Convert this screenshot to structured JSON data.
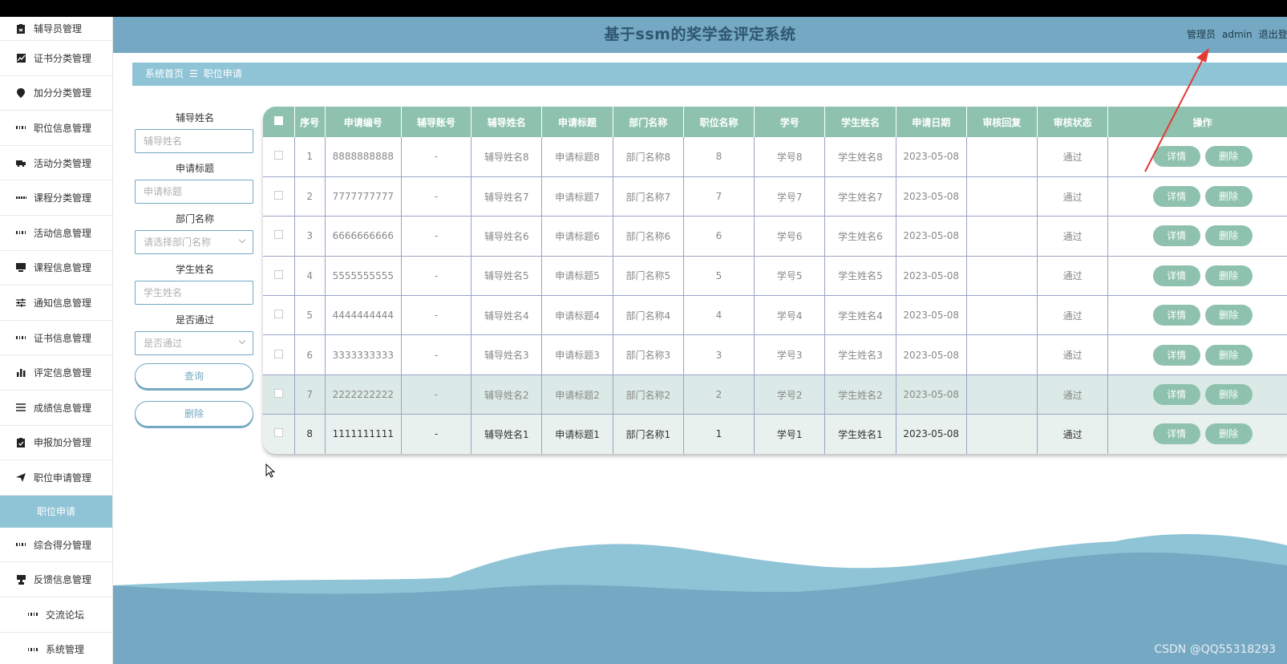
{
  "app": {
    "title": "基于ssm的奖学金评定系统"
  },
  "header": {
    "user_role": "管理员",
    "user_name": "admin",
    "logout": "退出登录"
  },
  "sidebar": {
    "items": [
      {
        "label": "辅导员管理",
        "icon": "clipboard-icon"
      },
      {
        "label": "证书分类管理",
        "icon": "chart-icon"
      },
      {
        "label": "加分分类管理",
        "icon": "pin-icon"
      },
      {
        "label": "职位信息管理",
        "icon": "grid-icon"
      },
      {
        "label": "活动分类管理",
        "icon": "truck-icon"
      },
      {
        "label": "课程分类管理",
        "icon": "grid9-icon"
      },
      {
        "label": "活动信息管理",
        "icon": "grid-icon"
      },
      {
        "label": "课程信息管理",
        "icon": "monitor-icon"
      },
      {
        "label": "通知信息管理",
        "icon": "sliders-icon"
      },
      {
        "label": "证书信息管理",
        "icon": "grid-icon"
      },
      {
        "label": "评定信息管理",
        "icon": "bar-chart-icon"
      },
      {
        "label": "成绩信息管理",
        "icon": "list-icon"
      },
      {
        "label": "申报加分管理",
        "icon": "clipboard-check-icon"
      },
      {
        "label": "职位申请管理",
        "icon": "send-icon"
      },
      {
        "label": "职位申请",
        "icon": "",
        "active": true
      },
      {
        "label": "综合得分管理",
        "icon": "grid-icon"
      },
      {
        "label": "反馈信息管理",
        "icon": "stamp-icon"
      },
      {
        "label": "交流论坛",
        "icon": "grid-icon"
      },
      {
        "label": "系统管理",
        "icon": "grid-icon"
      }
    ]
  },
  "breadcrumb": {
    "home": "系统首页",
    "separator": "☰",
    "current": "职位申请"
  },
  "search": {
    "fields": [
      {
        "label": "辅导姓名",
        "placeholder": "辅导姓名",
        "type": "input"
      },
      {
        "label": "申请标题",
        "placeholder": "申请标题",
        "type": "input"
      },
      {
        "label": "部门名称",
        "placeholder": "请选择部门名称",
        "type": "select"
      },
      {
        "label": "学生姓名",
        "placeholder": "学生姓名",
        "type": "input"
      },
      {
        "label": "是否通过",
        "placeholder": "是否通过",
        "type": "select"
      }
    ],
    "query_button": "查询",
    "delete_button": "删除"
  },
  "table": {
    "columns": [
      "序号",
      "申请编号",
      "辅导账号",
      "辅导姓名",
      "申请标题",
      "部门名称",
      "职位名称",
      "学号",
      "学生姓名",
      "申请日期",
      "审核回复",
      "审核状态",
      "操作"
    ],
    "rows": [
      [
        "1",
        "8888888888",
        "-",
        "辅导姓名8",
        "申请标题8",
        "部门名称8",
        "8",
        "学号8",
        "学生姓名8",
        "2023-05-08",
        "",
        "通过"
      ],
      [
        "2",
        "7777777777",
        "-",
        "辅导姓名7",
        "申请标题7",
        "部门名称7",
        "7",
        "学号7",
        "学生姓名7",
        "2023-05-08",
        "",
        "通过"
      ],
      [
        "3",
        "6666666666",
        "-",
        "辅导姓名6",
        "申请标题6",
        "部门名称6",
        "6",
        "学号6",
        "学生姓名6",
        "2023-05-08",
        "",
        "通过"
      ],
      [
        "4",
        "5555555555",
        "-",
        "辅导姓名5",
        "申请标题5",
        "部门名称5",
        "5",
        "学号5",
        "学生姓名5",
        "2023-05-08",
        "",
        "通过"
      ],
      [
        "5",
        "4444444444",
        "-",
        "辅导姓名4",
        "申请标题4",
        "部门名称4",
        "4",
        "学号4",
        "学生姓名4",
        "2023-05-08",
        "",
        "通过"
      ],
      [
        "6",
        "3333333333",
        "-",
        "辅导姓名3",
        "申请标题3",
        "部门名称3",
        "3",
        "学号3",
        "学生姓名3",
        "2023-05-08",
        "",
        "通过"
      ],
      [
        "7",
        "2222222222",
        "-",
        "辅导姓名2",
        "申请标题2",
        "部门名称2",
        "2",
        "学号2",
        "学生姓名2",
        "2023-05-08",
        "",
        "通过"
      ],
      [
        "8",
        "1111111111",
        "-",
        "辅导姓名1",
        "申请标题1",
        "部门名称1",
        "1",
        "学号1",
        "学生姓名1",
        "2023-05-08",
        "",
        "通过"
      ]
    ],
    "row_actions": {
      "detail": "详情",
      "delete": "删除"
    }
  },
  "watermark": "CSDN @QQ55318293",
  "colors": {
    "header": "#74a8c3",
    "accent": "#8fc4d6",
    "table_header": "#8fc2ae",
    "annotation_arrow": "#e53935"
  }
}
